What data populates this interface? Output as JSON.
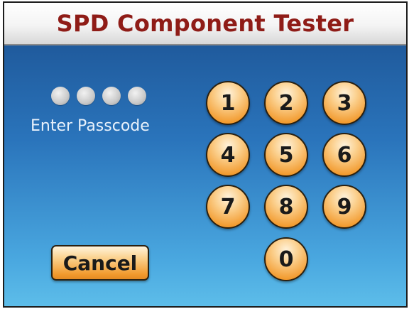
{
  "app": {
    "title": "SPD Component Tester"
  },
  "passcode": {
    "prompt": "Enter Passcode",
    "indicator_count": 4
  },
  "keypad": {
    "keys": [
      "1",
      "2",
      "3",
      "4",
      "5",
      "6",
      "7",
      "8",
      "9",
      "0"
    ]
  },
  "cancel": {
    "label": "Cancel"
  },
  "colors": {
    "title_text": "#8f1c17",
    "key_orange": "#f29a2e",
    "background_top": "#1b4f8f",
    "background_bottom": "#5dbde9"
  }
}
